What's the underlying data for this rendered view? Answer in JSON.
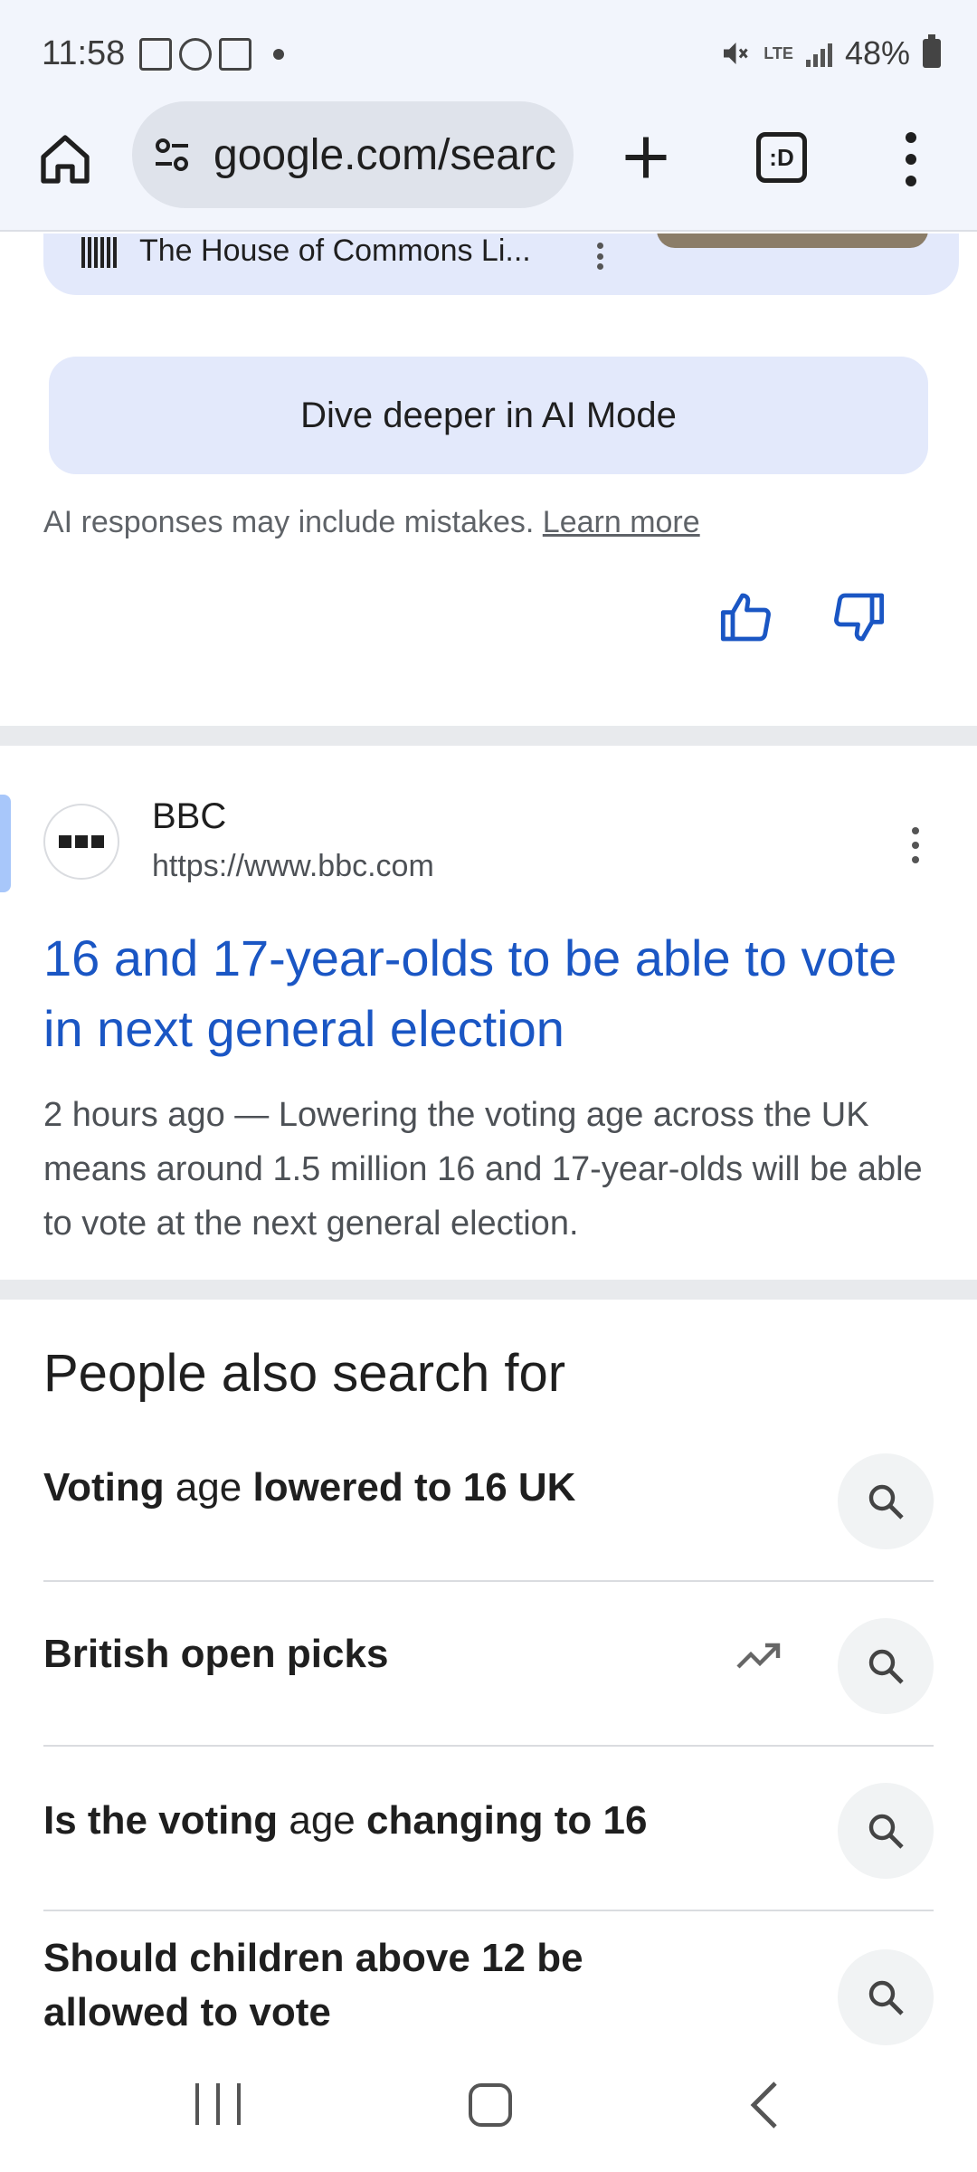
{
  "status_bar": {
    "time": "11:58",
    "battery": "48%",
    "network": "LTE",
    "icons": [
      "news-icon",
      "stop-icon",
      "image-icon",
      "dot-icon",
      "mute-icon",
      "lte-icon",
      "signal-icon",
      "battery-icon"
    ]
  },
  "browser": {
    "url": "google.com/searc",
    "tab_switcher_label": ":D",
    "icons": [
      "home-icon",
      "site-settings-icon",
      "new-tab-icon",
      "tab-switcher-icon",
      "overflow-menu-icon"
    ]
  },
  "ai_overview": {
    "source_name": "The House of Commons Li...",
    "ai_mode_button": "Dive deeper in AI Mode",
    "disclaimer": "AI responses may include mistakes.",
    "learn_more": "Learn more",
    "feedback_icons": [
      "thumbs-up-icon",
      "thumbs-down-icon"
    ]
  },
  "result": {
    "site_name": "BBC",
    "url": "https://www.bbc.com",
    "title": "16 and 17-year-olds to be able to vote in next general election",
    "snippet": "2 hours ago — Lowering the voting age across the UK means around 1.5 million 16 and 17-year-olds will be able to vote at the next general election."
  },
  "people_also_search": {
    "heading": "People also search for",
    "items": [
      {
        "parts": [
          {
            "text": "Voting ",
            "bold": true
          },
          {
            "text": "age",
            "bold": false
          },
          {
            "text": " lowered to 16 UK",
            "bold": true
          }
        ],
        "trending": false
      },
      {
        "parts": [
          {
            "text": "British open picks",
            "bold": true
          }
        ],
        "trending": true
      },
      {
        "parts": [
          {
            "text": "Is the voting ",
            "bold": true
          },
          {
            "text": "age",
            "bold": false
          },
          {
            "text": " changing to 16",
            "bold": true
          }
        ],
        "trending": false
      },
      {
        "parts": [
          {
            "text": "Should children above 12 be allowed to vote",
            "bold": true
          }
        ],
        "trending": false
      }
    ]
  },
  "nav_bar": {
    "icons": [
      "recent-apps-icon",
      "home-button-icon",
      "back-icon"
    ]
  }
}
